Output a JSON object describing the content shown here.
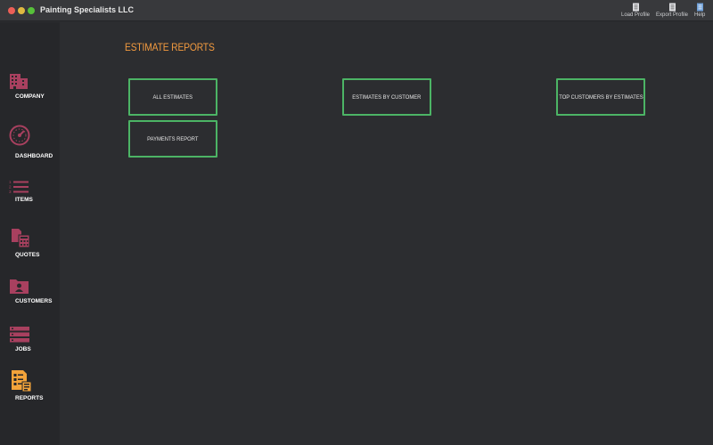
{
  "window": {
    "title": "Painting Specialists LLC"
  },
  "toolbar": [
    {
      "label": "Load Profile",
      "icon": "document-icon"
    },
    {
      "label": "Export Profile",
      "icon": "document-icon"
    },
    {
      "label": "Help",
      "icon": "help-icon"
    }
  ],
  "sidebar": {
    "items": [
      {
        "label": "COMPANY",
        "icon": "building-icon",
        "active": false
      },
      {
        "label": "DASHBOARD",
        "icon": "gauge-icon",
        "active": false
      },
      {
        "label": "ITEMS",
        "icon": "list-icon",
        "active": false
      },
      {
        "label": "QUOTES",
        "icon": "quote-documents-icon",
        "active": false
      },
      {
        "label": "CUSTOMERS",
        "icon": "customer-card-icon",
        "active": false
      },
      {
        "label": "JOBS",
        "icon": "jobs-stack-icon",
        "active": false
      },
      {
        "label": "REPORTS",
        "icon": "reports-icon",
        "active": true
      }
    ]
  },
  "main": {
    "title": "ESTIMATE REPORTS",
    "buttons": [
      {
        "label": "ALL ESTIMATES"
      },
      {
        "label": "ESTIMATES BY CUSTOMER"
      },
      {
        "label": "TOP CUSTOMERS BY ESTIMATES"
      },
      {
        "label": "PAYMENTS REPORT"
      }
    ]
  },
  "colors": {
    "background": "#2c2d30",
    "sidebar": "#26272a",
    "accent": "#f29a3f",
    "icon": "#a8405f",
    "active_icon": "#f2a33a",
    "button_border": "#4cb465"
  }
}
